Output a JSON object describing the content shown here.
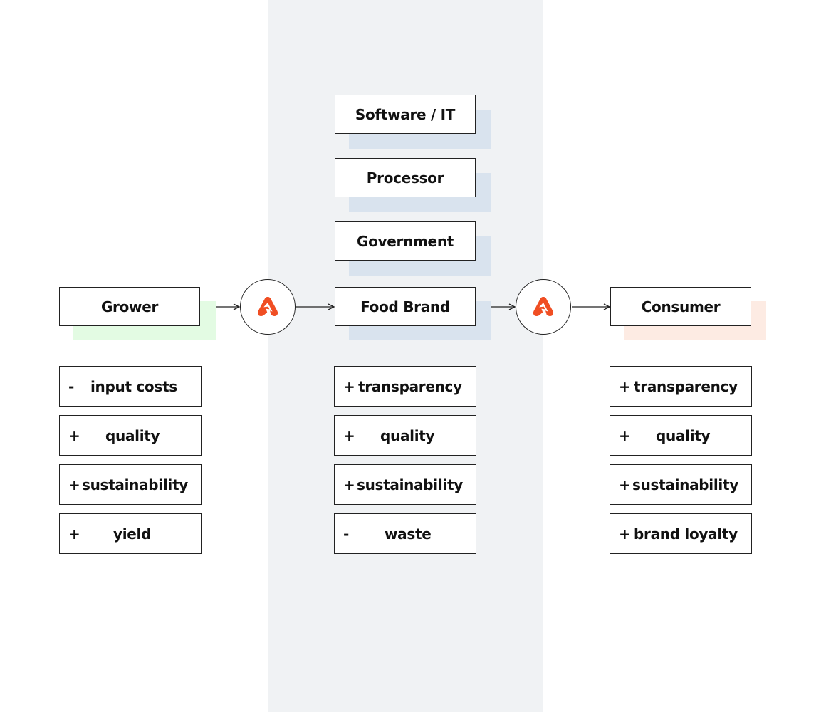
{
  "colors": {
    "band": "#f0f2f4",
    "shadow_grower": "#e3fbe3",
    "shadow_food": "#d9e3ee",
    "shadow_consumer": "#fdebe3",
    "logo": "#f04e23"
  },
  "stakeholders": {
    "software": "Software / IT",
    "processor": "Processor",
    "government": "Government"
  },
  "flow": {
    "grower": "Grower",
    "food_brand": "Food Brand",
    "consumer": "Consumer",
    "node_icon": "logo-mark-icon"
  },
  "benefits": {
    "grower": [
      {
        "sign": "-",
        "label": "input costs"
      },
      {
        "sign": "+",
        "label": "quality"
      },
      {
        "sign": "+",
        "label": "sustainability"
      },
      {
        "sign": "+",
        "label": "yield"
      }
    ],
    "food_brand": [
      {
        "sign": "+",
        "label": "transparency"
      },
      {
        "sign": "+",
        "label": "quality"
      },
      {
        "sign": "+",
        "label": "sustainability"
      },
      {
        "sign": "-",
        "label": "waste"
      }
    ],
    "consumer": [
      {
        "sign": "+",
        "label": "transparency"
      },
      {
        "sign": "+",
        "label": "quality"
      },
      {
        "sign": "+",
        "label": "sustainability"
      },
      {
        "sign": "+",
        "label": "brand loyalty"
      }
    ]
  }
}
